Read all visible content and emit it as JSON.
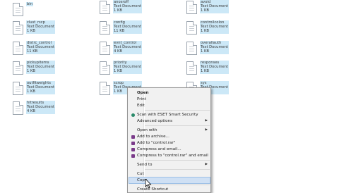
{
  "columns": [
    [
      {
        "name": "bin",
        "type": "",
        "size": ""
      },
      {
        "name": "clust_rscp",
        "type": "Text Document",
        "size": "1 KB"
      },
      {
        "name": "distrc_control",
        "type": "Text Document",
        "size": "11 KB"
      },
      {
        "name": "pickupitems",
        "type": "Text Document",
        "size": "1 KB"
      },
      {
        "name": "outfitweights",
        "type": "Text Document",
        "size": "1 KB"
      },
      {
        "name": "hitresults",
        "type": "Text Document",
        "size": "4 KB"
      }
    ],
    [
      {
        "name": "anosroff",
        "type": "Text Document",
        "size": "1 KB"
      },
      {
        "name": "config",
        "type": "Text Document",
        "size": "11 KB"
      },
      {
        "name": "evnt_control",
        "type": "Text Document",
        "size": "4 KB"
      },
      {
        "name": "priority",
        "type": "Text Document",
        "size": "1 KB"
      },
      {
        "name": "scrop",
        "type": "Text Document",
        "size": "1 KB"
      }
    ],
    [
      {
        "name": "avoid",
        "type": "Text Document",
        "size": "1 KB"
      },
      {
        "name": "controllcolon",
        "type": "Text Document",
        "size": "1 KB"
      },
      {
        "name": "overallauth",
        "type": "Text Document",
        "size": "1 KB"
      },
      {
        "name": "responses",
        "type": "Text Document",
        "size": "1 KB"
      },
      {
        "name": "sys",
        "type": "Text Document",
        "size": "1 KB"
      }
    ]
  ],
  "context_menu": {
    "items": [
      {
        "label": "Open",
        "bold": true,
        "icon": "",
        "submenu": false
      },
      {
        "label": "Print",
        "bold": false,
        "icon": "",
        "submenu": false
      },
      {
        "label": "Edit",
        "bold": false,
        "icon": "",
        "submenu": false
      },
      {
        "label": "Scan with ESET Smart Security",
        "bold": false,
        "icon": "eset-icon",
        "submenu": false
      },
      {
        "label": "Advanced options",
        "bold": false,
        "icon": "",
        "submenu": true
      },
      {
        "label": "Open with",
        "bold": false,
        "icon": "",
        "submenu": true
      },
      {
        "label": "Add to archive...",
        "bold": false,
        "icon": "winrar-icon",
        "submenu": false
      },
      {
        "label": "Add to \"control.rar\"",
        "bold": false,
        "icon": "winrar-icon",
        "submenu": false
      },
      {
        "label": "Compress and email...",
        "bold": false,
        "icon": "winrar-icon",
        "submenu": false
      },
      {
        "label": "Compress to \"control.rar\" and email",
        "bold": false,
        "icon": "winrar-icon",
        "submenu": false
      },
      {
        "label": "Send to",
        "bold": false,
        "icon": "",
        "submenu": true
      },
      {
        "label": "Cut",
        "bold": false,
        "icon": "",
        "submenu": false
      },
      {
        "label": "Copy",
        "bold": false,
        "icon": "",
        "submenu": false,
        "highlighted": true
      },
      {
        "label": "Create Shortcut",
        "bold": false,
        "icon": "",
        "submenu": false
      }
    ]
  },
  "colors": {
    "selection": "#cce8f7",
    "menu_bg": "#f1f1f1",
    "menu_highlight": "#cfe0f4",
    "winrar": "#7a3a8a",
    "eset": "#2a8a6a"
  }
}
